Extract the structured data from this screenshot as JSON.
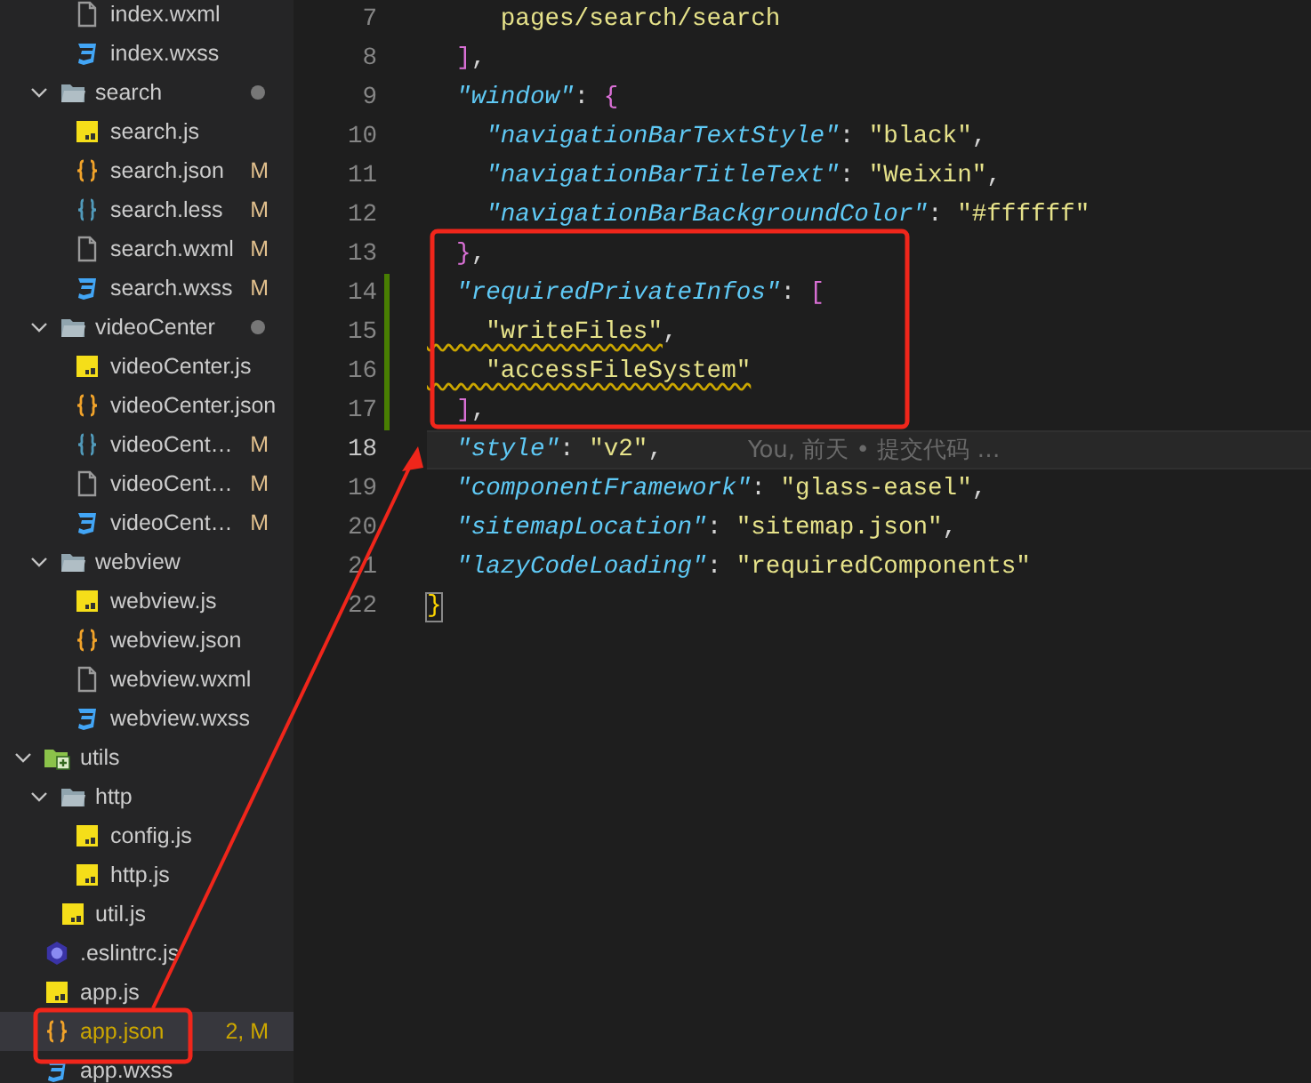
{
  "explorer": {
    "items": [
      {
        "children": [
          {
            "children": [
              {
                "name": "index.wxml",
                "kind": "wxml",
                "selected": false
              },
              {
                "name": "index.wxss",
                "kind": "wxss",
                "selected": false
              }
            ]
          },
          {
            "name": "search",
            "kind": "folder",
            "expanded": true,
            "dot": true,
            "selected": false,
            "children": [
              {
                "name": "search.js",
                "kind": "js",
                "selected": false
              },
              {
                "name": "search.json",
                "kind": "json",
                "selected": false,
                "status": "M"
              },
              {
                "name": "search.less",
                "kind": "less",
                "selected": false,
                "status": "M"
              },
              {
                "name": "search.wxml",
                "kind": "wxml",
                "selected": false,
                "status": "M"
              },
              {
                "name": "search.wxss",
                "kind": "wxss",
                "selected": false,
                "status": "M"
              }
            ]
          },
          {
            "name": "videoCenter",
            "kind": "folder",
            "expanded": true,
            "dot": true,
            "selected": false,
            "children": [
              {
                "name": "videoCenter.js",
                "kind": "js",
                "selected": false
              },
              {
                "name": "videoCenter.json",
                "kind": "json",
                "selected": false
              },
              {
                "name": "videoCent…",
                "kind": "less",
                "selected": false,
                "status": "M"
              },
              {
                "name": "videoCent…",
                "kind": "wxml",
                "selected": false,
                "status": "M"
              },
              {
                "name": "videoCent…",
                "kind": "wxss",
                "selected": false,
                "status": "M"
              }
            ]
          },
          {
            "name": "webview",
            "kind": "folder",
            "expanded": true,
            "selected": false,
            "children": [
              {
                "name": "webview.js",
                "kind": "js",
                "selected": false
              },
              {
                "name": "webview.json",
                "kind": "json",
                "selected": false
              },
              {
                "name": "webview.wxml",
                "kind": "wxml",
                "selected": false
              },
              {
                "name": "webview.wxss",
                "kind": "wxss",
                "selected": false
              }
            ]
          }
        ]
      },
      {
        "name": "utils",
        "kind": "folder-special",
        "expanded": true,
        "selected": false,
        "children": [
          {
            "name": "http",
            "kind": "folder",
            "expanded": true,
            "selected": false,
            "children": [
              {
                "name": "config.js",
                "kind": "js",
                "selected": false
              },
              {
                "name": "http.js",
                "kind": "js",
                "selected": false
              }
            ]
          },
          {
            "name": "util.js",
            "kind": "js",
            "selected": false
          }
        ]
      },
      {
        "name": ".eslintrc.js",
        "kind": "eslint",
        "selected": false
      },
      {
        "name": "app.js",
        "kind": "js",
        "selected": false
      },
      {
        "name": "app.json",
        "kind": "json",
        "selected": true,
        "warning": true,
        "status": "2, M"
      },
      {
        "name": "app.wxss",
        "kind": "wxss",
        "selected": false
      }
    ]
  },
  "editor": {
    "lines": [
      {
        "number": "7",
        "tokens": [
          {
            "kind": "str",
            "text": "     pages/search/search"
          }
        ]
      },
      {
        "number": "8",
        "tokens": [
          {
            "kind": "bracket",
            "color": "#da70d6",
            "text": "  ]"
          },
          {
            "kind": "punct",
            "text": ","
          }
        ]
      },
      {
        "number": "9",
        "tokens": [
          {
            "kind": "key",
            "text": "  \"window\""
          },
          {
            "kind": "punct",
            "text": ": "
          },
          {
            "kind": "bracket",
            "color": "#da70d6",
            "text": "{"
          }
        ]
      },
      {
        "number": "10",
        "tokens": [
          {
            "kind": "key",
            "text": "    \"navigationBarTextStyle\""
          },
          {
            "kind": "punct",
            "text": ": "
          },
          {
            "kind": "str",
            "text": "\"black\""
          },
          {
            "kind": "punct",
            "text": ","
          }
        ]
      },
      {
        "number": "11",
        "tokens": [
          {
            "kind": "key",
            "text": "    \"navigationBarTitleText\""
          },
          {
            "kind": "punct",
            "text": ": "
          },
          {
            "kind": "str",
            "text": "\"Weixin\""
          },
          {
            "kind": "punct",
            "text": ","
          }
        ]
      },
      {
        "number": "12",
        "tokens": [
          {
            "kind": "key",
            "text": "    \"navigationBarBackgroundColor\""
          },
          {
            "kind": "punct",
            "text": ": "
          },
          {
            "kind": "str",
            "text": "\"#ffffff\""
          }
        ]
      },
      {
        "number": "13",
        "tokens": [
          {
            "kind": "bracket",
            "color": "#da70d6",
            "text": "  }"
          },
          {
            "kind": "punct",
            "text": ","
          }
        ]
      },
      {
        "number": "14",
        "changed": true,
        "tokens": [
          {
            "kind": "key",
            "text": "  \"requiredPrivateInfos\""
          },
          {
            "kind": "punct",
            "text": ": "
          },
          {
            "kind": "bracket",
            "color": "#da70d6",
            "text": "["
          }
        ]
      },
      {
        "number": "15",
        "changed": true,
        "tokens": [
          {
            "kind": "str",
            "warning": true,
            "text": "    \"writeFiles\""
          },
          {
            "kind": "punct",
            "text": ","
          }
        ]
      },
      {
        "number": "16",
        "changed": true,
        "tokens": [
          {
            "kind": "str",
            "warning": true,
            "text": "    \"accessFileSystem\""
          }
        ]
      },
      {
        "number": "17",
        "changed": true,
        "tokens": [
          {
            "kind": "bracket",
            "color": "#da70d6",
            "text": "  ]"
          },
          {
            "kind": "punct",
            "text": ","
          }
        ]
      },
      {
        "number": "18",
        "current": true,
        "blame": "You, 前天 • 提交代码 …",
        "tokens": [
          {
            "kind": "key",
            "text": "  \"style\""
          },
          {
            "kind": "punct",
            "text": ": "
          },
          {
            "kind": "str",
            "text": "\"v2\""
          },
          {
            "kind": "punct",
            "text": ","
          }
        ]
      },
      {
        "number": "19",
        "tokens": [
          {
            "kind": "key",
            "text": "  \"componentFramework\""
          },
          {
            "kind": "punct",
            "text": ": "
          },
          {
            "kind": "str",
            "text": "\"glass-easel\""
          },
          {
            "kind": "punct",
            "text": ","
          }
        ]
      },
      {
        "number": "20",
        "tokens": [
          {
            "kind": "key",
            "text": "  \"sitemapLocation\""
          },
          {
            "kind": "punct",
            "text": ": "
          },
          {
            "kind": "str",
            "text": "\"sitemap.json\""
          },
          {
            "kind": "punct",
            "text": ","
          }
        ]
      },
      {
        "number": "21",
        "tokens": [
          {
            "kind": "key",
            "text": "  \"lazyCodeLoading\""
          },
          {
            "kind": "punct",
            "text": ": "
          },
          {
            "kind": "str",
            "text": "\"requiredComponents\""
          }
        ]
      },
      {
        "number": "22",
        "tokens": [
          {
            "kind": "bracket",
            "color": "#ffd700",
            "matched": true,
            "text": "}"
          }
        ]
      }
    ]
  }
}
